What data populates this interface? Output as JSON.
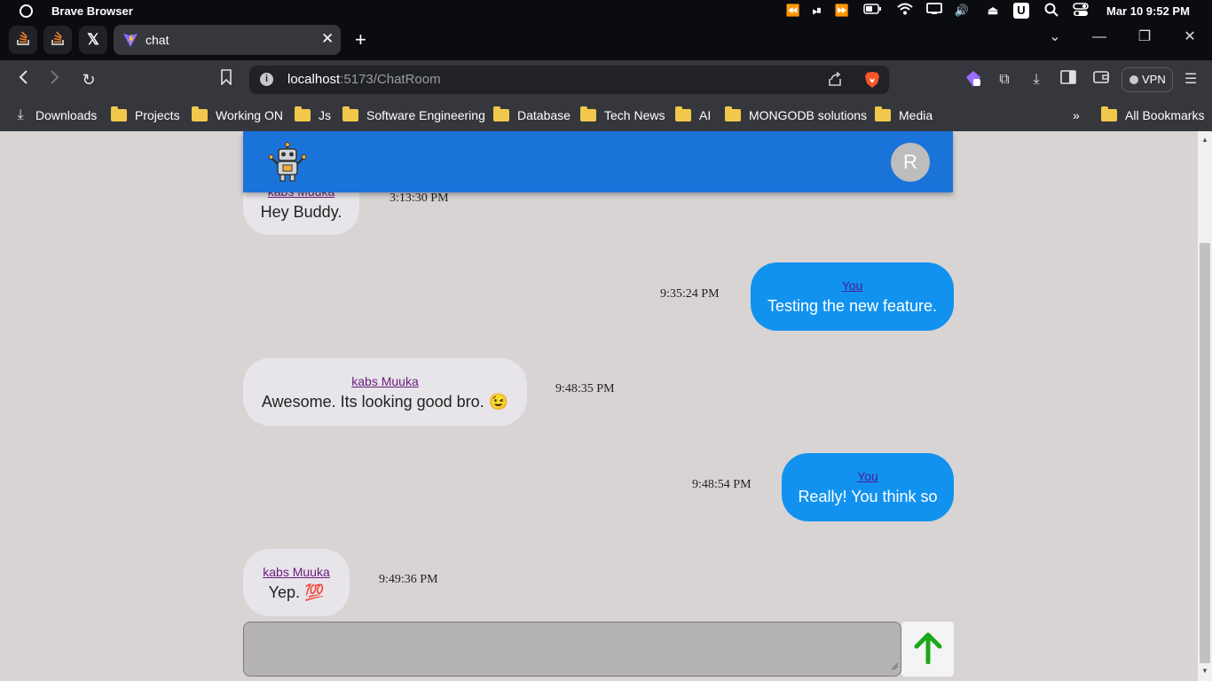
{
  "os": {
    "app_name": "Brave Browser",
    "clock": "Mar 10  9:52 PM",
    "icons": [
      "rewind-icon",
      "play-pause-icon",
      "fast-forward-icon",
      "battery-icon",
      "wifi-icon",
      "display-icon",
      "volume-icon",
      "eject-icon",
      "u-app-icon",
      "search-icon",
      "control-center-icon"
    ]
  },
  "tabs": {
    "pinned": [
      "stackoverflow-icon",
      "stackoverflow-icon",
      "x-icon"
    ],
    "active_title": "chat",
    "close": "✕",
    "new_tab": "+"
  },
  "toolbar": {
    "url_host": "localhost",
    "url_rest": ":5173/ChatRoom",
    "vpn_label": "VPN"
  },
  "bookmarks": {
    "items": [
      "Downloads",
      "Projects",
      "Working ON",
      "Js",
      "Software Engineering",
      "Database",
      "Tech News",
      "AI",
      "MONGODB solutions",
      "Media"
    ],
    "overflow": "»",
    "all": "All Bookmarks"
  },
  "chat": {
    "header_avatar": "R",
    "messages": [
      {
        "sender": "kabs Muuka",
        "text": "Hey Buddy.",
        "time": "3:13:30 PM",
        "mine": false
      },
      {
        "sender": "You",
        "text": "Testing the new feature.",
        "time": "9:35:24 PM",
        "mine": true
      },
      {
        "sender": "kabs Muuka",
        "text": "Awesome. Its looking good bro. 😉",
        "time": "9:48:35 PM",
        "mine": false
      },
      {
        "sender": "You",
        "text": "Really! You think so",
        "time": "9:48:54 PM",
        "mine": true
      },
      {
        "sender": "kabs Muuka",
        "text": "Yep. 💯",
        "time": "9:49:36 PM",
        "mine": false
      }
    ]
  },
  "colors": {
    "header": "#1a73d8",
    "bubble_mine": "#1192ef",
    "bubble_other": "#e7e5e9",
    "send_arrow": "#1aa81a",
    "page_bg": "#d8d4d4"
  }
}
